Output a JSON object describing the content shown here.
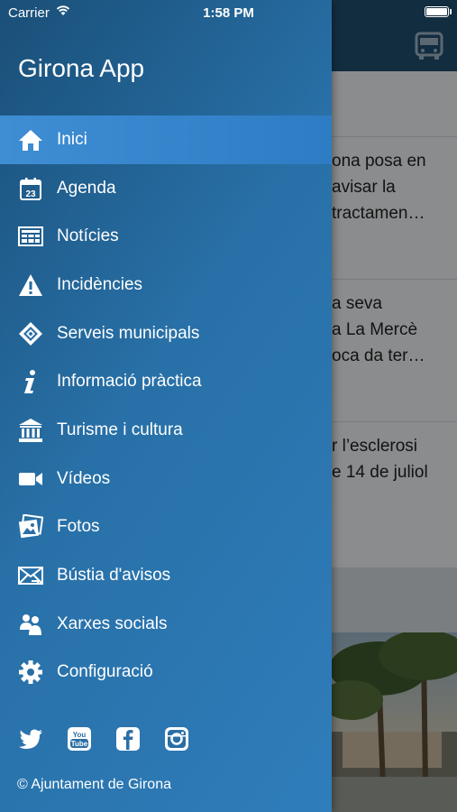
{
  "status_bar": {
    "carrier": "Carrier",
    "time": "1:58 PM"
  },
  "drawer": {
    "title": "Girona App",
    "menu": [
      {
        "label": "Inici",
        "icon": "home-icon",
        "active": true
      },
      {
        "label": "Agenda",
        "icon": "calendar-icon",
        "calendar_day": "23"
      },
      {
        "label": "Notícies",
        "icon": "news-icon"
      },
      {
        "label": "Incidències",
        "icon": "warning-icon"
      },
      {
        "label": "Serveis municipals",
        "icon": "municipal-services-icon"
      },
      {
        "label": "Informació pràctica",
        "icon": "info-icon"
      },
      {
        "label": "Turisme i cultura",
        "icon": "museum-icon"
      },
      {
        "label": "Vídeos",
        "icon": "video-camera-icon"
      },
      {
        "label": "Fotos",
        "icon": "photos-icon"
      },
      {
        "label": "Bústia d'avisos",
        "icon": "mailbox-icon"
      },
      {
        "label": "Xarxes socials",
        "icon": "people-icon"
      },
      {
        "label": "Configuració",
        "icon": "gear-icon"
      }
    ],
    "social": [
      "twitter-icon",
      "youtube-icon",
      "facebook-icon",
      "instagram-icon"
    ],
    "youtube_text": [
      "You",
      "Tube"
    ],
    "copyright": "© Ajuntament de Girona"
  },
  "background": {
    "items": [
      {
        "lines": [
          "ona posa en",
          "avisar la",
          "tractamen…"
        ]
      },
      {
        "lines": [
          "a seva",
          "a La Mercè",
          "oca da ter…"
        ]
      },
      {
        "lines": [
          "r l’esclerosi",
          "e 14 de juliol"
        ]
      }
    ]
  },
  "colors": {
    "drawer_top": "#1a4f78",
    "drawer_bottom": "#2f7dbb",
    "active_item": "#3f8ed4",
    "header": "#1f4f6e"
  }
}
